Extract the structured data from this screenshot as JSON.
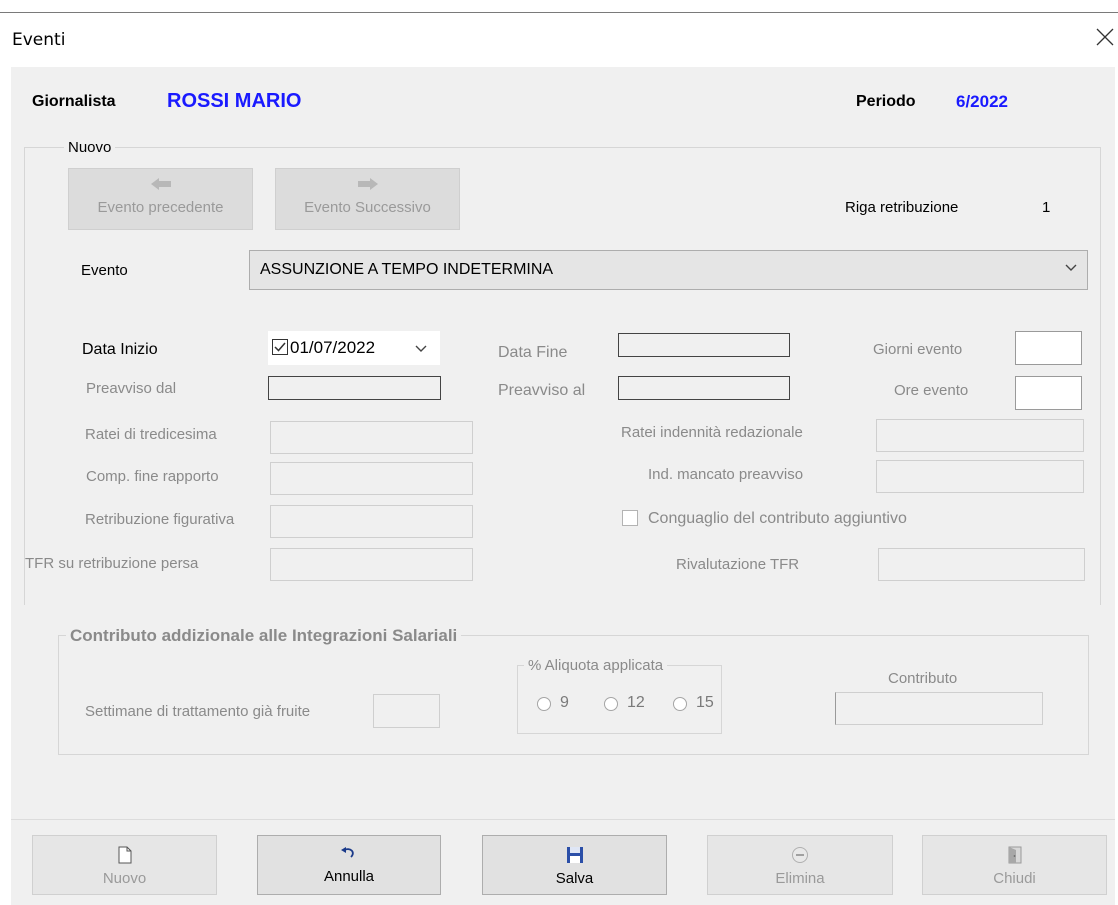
{
  "window": {
    "title": "Eventi"
  },
  "header": {
    "giornalista_label": "Giornalista",
    "giornalista_name": "ROSSI MARIO",
    "periodo_label": "Periodo",
    "periodo_value": "6/2022"
  },
  "nuovo_group": {
    "legend": "Nuovo",
    "prev_button": "Evento precedente",
    "next_button": "Evento Successivo",
    "riga_label": "Riga retribuzione",
    "riga_value": "1",
    "evento_label": "Evento",
    "evento_value": "ASSUNZIONE A TEMPO INDETERMINA"
  },
  "fields": {
    "data_inizio_label": "Data Inizio",
    "data_inizio_value": "01/07/2022",
    "data_inizio_checked": true,
    "data_fine_label": "Data Fine",
    "giorni_evento_label": "Giorni evento",
    "preavviso_dal_label": "Preavviso dal",
    "preavviso_al_label": "Preavviso al",
    "ore_evento_label": "Ore evento",
    "ratei_tredicesima_label": "Ratei di tredicesima",
    "ratei_indennita_label": "Ratei indennità redazionale",
    "comp_fine_rapporto_label": "Comp. fine rapporto",
    "ind_mancato_preavviso_label": "Ind. mancato preavviso",
    "retribuzione_figurativa_label": "Retribuzione figurativa",
    "conguaglio_label": "Conguaglio del contributo aggiuntivo",
    "tfr_retribuzione_persa_label": "TFR su retribuzione persa",
    "rivalutazione_tfr_label": "Rivalutazione TFR"
  },
  "contributo_group": {
    "legend": "Contributo addizionale alle Integrazioni Salariali",
    "settimane_label": "Settimane di trattamento già fruite",
    "aliquota_legend": "% Aliquota applicata",
    "aliquota_options": [
      "9",
      "12",
      "15"
    ],
    "contributo_label": "Contributo"
  },
  "actions": {
    "nuovo": "Nuovo",
    "annulla": "Annulla",
    "salva": "Salva",
    "elimina": "Elimina",
    "chiudi": "Chiudi"
  },
  "colors": {
    "accent_blue": "#1a1aff",
    "panel_bg": "#f0f0f0",
    "disabled_text": "#8a8a8a"
  },
  "icons": [
    "close-icon",
    "arrow-left-icon",
    "arrow-right-icon",
    "chevron-down-icon",
    "checkbox-checked-icon",
    "new-document-icon",
    "undo-icon",
    "floppy-disk-icon",
    "delete-circle-icon",
    "exit-door-icon"
  ]
}
